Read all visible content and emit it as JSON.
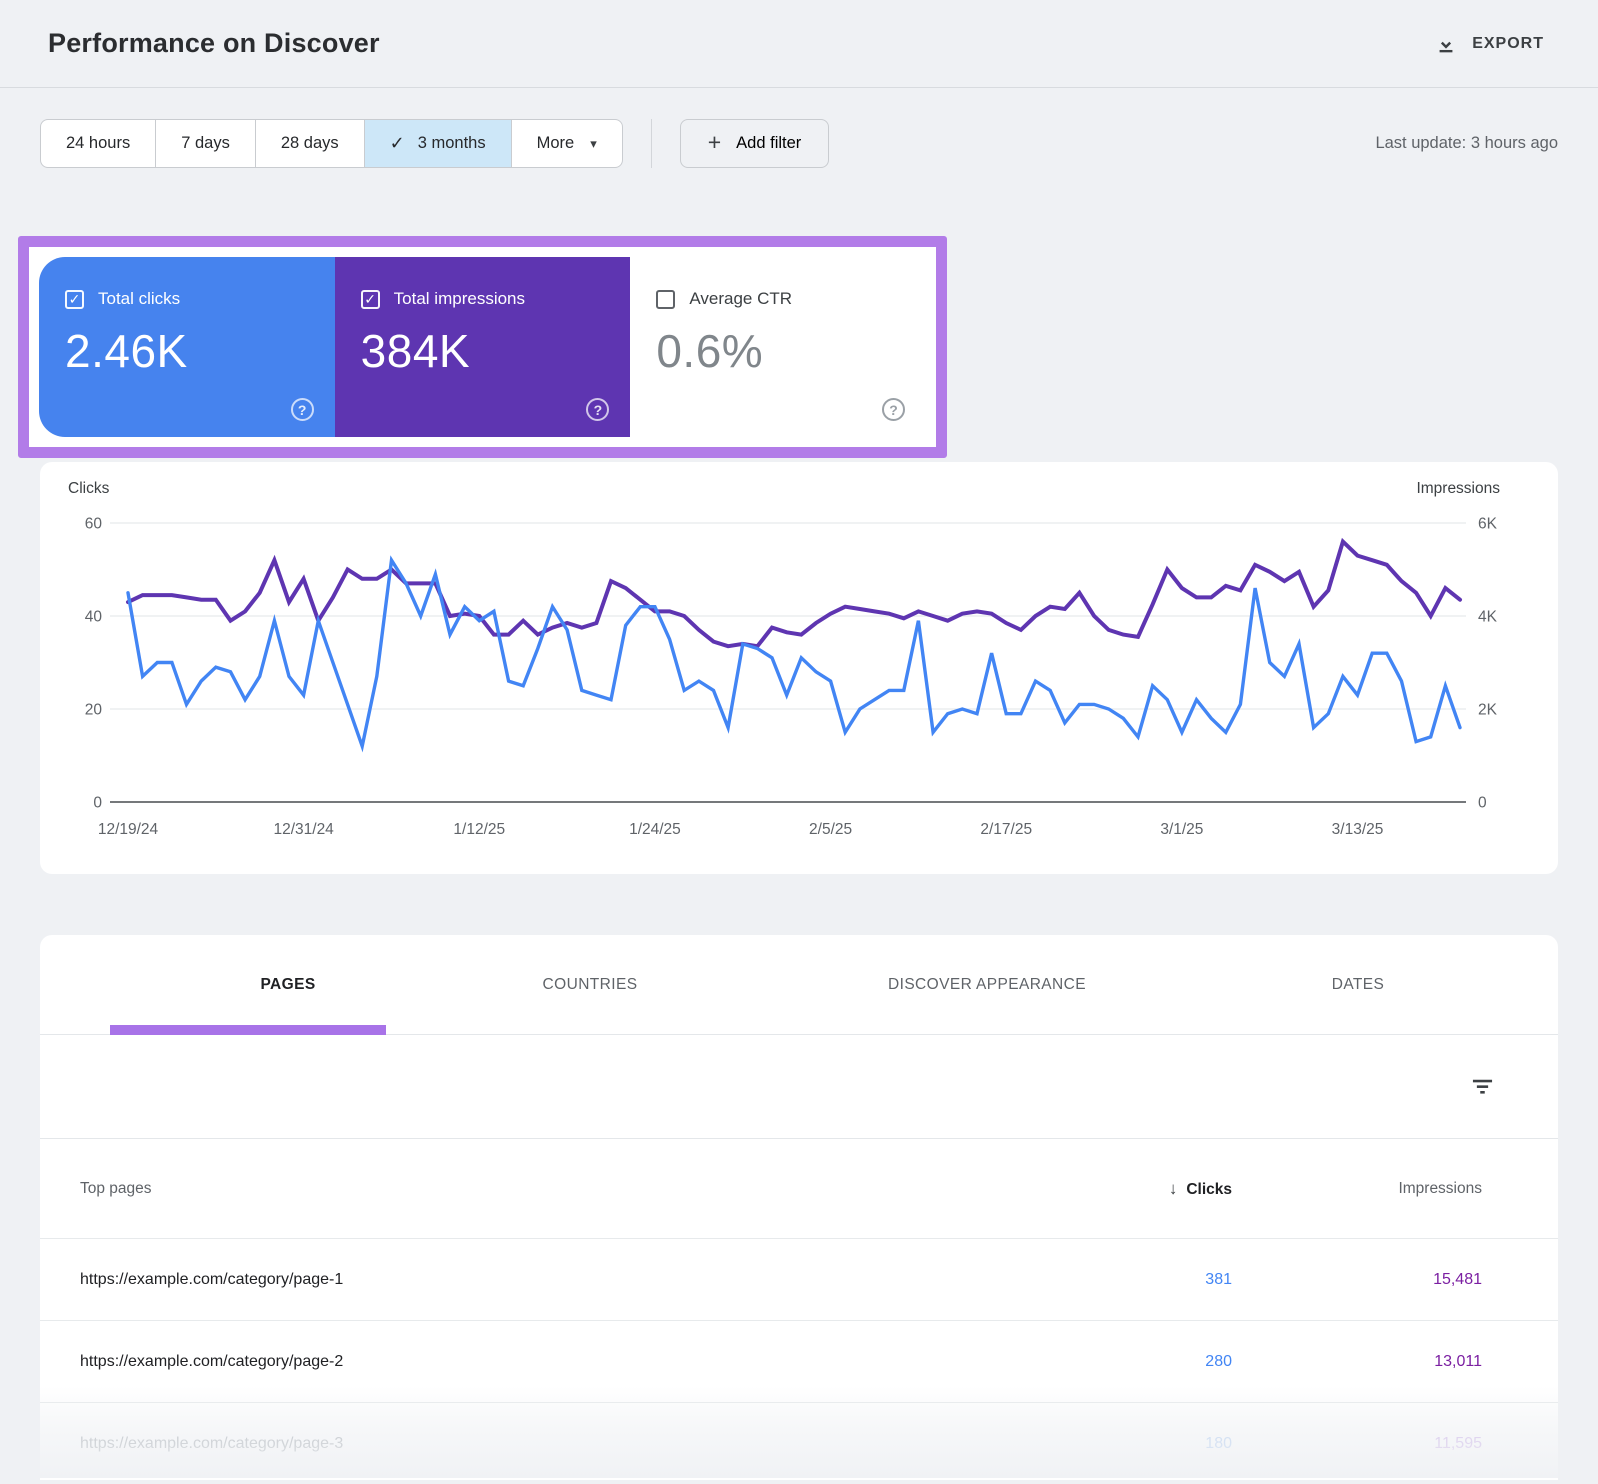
{
  "header": {
    "title": "Performance on Discover",
    "export_label": "EXPORT"
  },
  "filters": {
    "ranges": [
      "24 hours",
      "7 days",
      "28 days",
      "3 months"
    ],
    "selected": "3 months",
    "more_label": "More",
    "add_filter_label": "Add filter",
    "last_update": "Last update: 3 hours ago"
  },
  "icons": {
    "check": "✓",
    "caret_down": "▾",
    "plus": "+",
    "sort_desc": "↓",
    "help": "?"
  },
  "metrics": {
    "cards": [
      {
        "id": "total-clicks",
        "label": "Total clicks",
        "value": "2.46K",
        "checked": true,
        "style": "blue"
      },
      {
        "id": "total-impressions",
        "label": "Total impressions",
        "value": "384K",
        "checked": true,
        "style": "purple"
      },
      {
        "id": "average-ctr",
        "label": "Average CTR",
        "value": "0.6%",
        "checked": false,
        "style": "white"
      }
    ]
  },
  "chart_data": {
    "type": "line",
    "left_axis": {
      "title": "Clicks",
      "ticks": [
        0,
        20,
        40,
        60
      ],
      "max": 60
    },
    "right_axis": {
      "title": "Impressions",
      "tick_labels": [
        "0",
        "2K",
        "4K",
        "6K"
      ],
      "ticks": [
        0,
        2,
        4,
        6
      ],
      "max": 6
    },
    "x_tick_labels": [
      {
        "label": "12/19/24",
        "index": 0
      },
      {
        "label": "12/31/24",
        "index": 12
      },
      {
        "label": "1/12/25",
        "index": 24
      },
      {
        "label": "1/24/25",
        "index": 36
      },
      {
        "label": "2/5/25",
        "index": 48
      },
      {
        "label": "2/17/25",
        "index": 60
      },
      {
        "label": "3/1/25",
        "index": 72
      },
      {
        "label": "3/13/25",
        "index": 84
      }
    ],
    "grid": "horizontal",
    "legend": "none",
    "series": [
      {
        "name": "Impressions",
        "axis": "right",
        "unit": "K",
        "color": "#5e35b1",
        "values": [
          4.3,
          4.45,
          4.45,
          4.45,
          4.4,
          4.35,
          4.35,
          3.9,
          4.1,
          4.5,
          5.2,
          4.3,
          4.8,
          3.9,
          4.4,
          5.0,
          4.8,
          4.8,
          5.0,
          4.7,
          4.7,
          4.7,
          4.0,
          4.05,
          4.0,
          3.6,
          3.6,
          3.9,
          3.6,
          3.75,
          3.85,
          3.75,
          3.85,
          4.75,
          4.6,
          4.35,
          4.1,
          4.1,
          4.0,
          3.7,
          3.45,
          3.35,
          3.4,
          3.35,
          3.75,
          3.65,
          3.6,
          3.85,
          4.05,
          4.2,
          4.15,
          4.1,
          4.05,
          3.95,
          4.1,
          4.0,
          3.9,
          4.05,
          4.1,
          4.05,
          3.85,
          3.7,
          4.0,
          4.2,
          4.15,
          4.5,
          4.0,
          3.7,
          3.6,
          3.55,
          4.25,
          5.0,
          4.6,
          4.4,
          4.4,
          4.65,
          4.55,
          5.1,
          4.95,
          4.75,
          4.95,
          4.2,
          4.55,
          5.6,
          5.3,
          5.2,
          5.1,
          4.75,
          4.5,
          4.0,
          4.6,
          4.35
        ]
      },
      {
        "name": "Clicks",
        "axis": "left",
        "unit": "",
        "color": "#4285f4",
        "values": [
          45,
          27,
          30,
          30,
          21,
          26,
          29,
          28,
          22,
          27,
          39,
          27,
          23,
          39,
          30,
          21,
          12,
          27,
          52,
          47,
          40,
          49,
          36,
          42,
          39,
          41,
          26,
          25,
          33,
          42,
          37,
          24,
          23,
          22,
          38,
          42,
          42,
          35,
          24,
          26,
          24,
          16,
          34,
          33,
          31,
          23,
          31,
          28,
          26,
          15,
          20,
          22,
          24,
          24,
          39,
          15,
          19,
          20,
          19,
          32,
          19,
          19,
          26,
          24,
          17,
          21,
          21,
          20,
          18,
          14,
          25,
          22,
          15,
          22,
          18,
          15,
          21,
          46,
          30,
          27,
          34,
          16,
          19,
          27,
          23,
          32,
          32,
          26,
          13,
          14,
          25,
          16
        ]
      }
    ]
  },
  "tabs": {
    "items": [
      "PAGES",
      "COUNTRIES",
      "DISCOVER APPEARANCE",
      "DATES"
    ],
    "active": "PAGES"
  },
  "table": {
    "columns": {
      "pages": "Top pages",
      "clicks": "Clicks",
      "impressions": "Impressions"
    },
    "rows": [
      {
        "url": "https://example.com/category/page-1",
        "clicks": "381",
        "impressions": "15,481",
        "faded": false
      },
      {
        "url": "https://example.com/category/page-2",
        "clicks": "280",
        "impressions": "13,011",
        "faded": false
      },
      {
        "url": "https://example.com/category/page-3",
        "clicks": "180",
        "impressions": "11,595",
        "faded": true
      }
    ]
  },
  "colors": {
    "blue": "#4285f4",
    "card-blue": "#4683ee",
    "card-purple": "#5e35b1",
    "value-purple": "#7b1fa2",
    "chip-sel": "#cde7f8",
    "annotation": "#b27ce8",
    "underline": "#a873e8"
  }
}
